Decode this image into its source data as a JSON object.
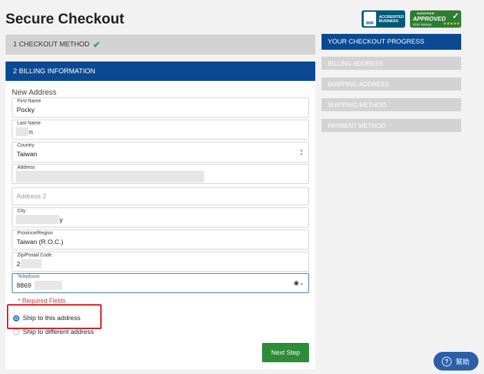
{
  "header": {
    "title": "Secure Checkout"
  },
  "badges": {
    "bbb": {
      "seal": "BBB",
      "line1": "ACCREDITED",
      "line2": "BUSINESS"
    },
    "shopper": {
      "top": "SHOPPER",
      "main": "APPROVED",
      "ratings": "201K Ratings",
      "stars": "★★★★★"
    }
  },
  "steps": {
    "step1": {
      "label": "1 CHECKOUT METHOD",
      "check": "✔"
    },
    "step2": {
      "label": "2 BILLING INFORMATION"
    }
  },
  "form": {
    "section_title": "New Address",
    "first_name": {
      "label": "First Name",
      "value": "Pocky"
    },
    "last_name": {
      "label": "Last Name",
      "value": "n"
    },
    "country": {
      "label": "Country",
      "value": "Taiwan"
    },
    "address": {
      "label": "Address",
      "value": ""
    },
    "address2": {
      "placeholder": "Address 2"
    },
    "city": {
      "label": "City",
      "value": "y"
    },
    "province": {
      "label": "Province/Region",
      "value": "Taiwan (R.O.C.)"
    },
    "zip": {
      "label": "Zip/Postal Code",
      "value": "2"
    },
    "telephone": {
      "label": "Telephone",
      "value": "8869"
    },
    "required_note": "* Required Fields",
    "ship_options": [
      {
        "label": "Ship to this address",
        "selected": true
      },
      {
        "label": "Ship to different address",
        "selected": false
      }
    ],
    "next_button": "Next Step"
  },
  "progress": {
    "title": "YOUR CHECKOUT PROGRESS",
    "items": [
      "BILLING ADDRESS",
      "SHIPPING ADDRESS",
      "SHIPPING METHOD",
      "PAYMENT METHOD"
    ]
  },
  "help": {
    "icon": "?",
    "label": "幫助"
  },
  "colors": {
    "accent_blue": "#0b4a93",
    "button_green": "#2e8b3a",
    "required_red": "#c23b3b",
    "highlight_red": "#d9171e"
  }
}
